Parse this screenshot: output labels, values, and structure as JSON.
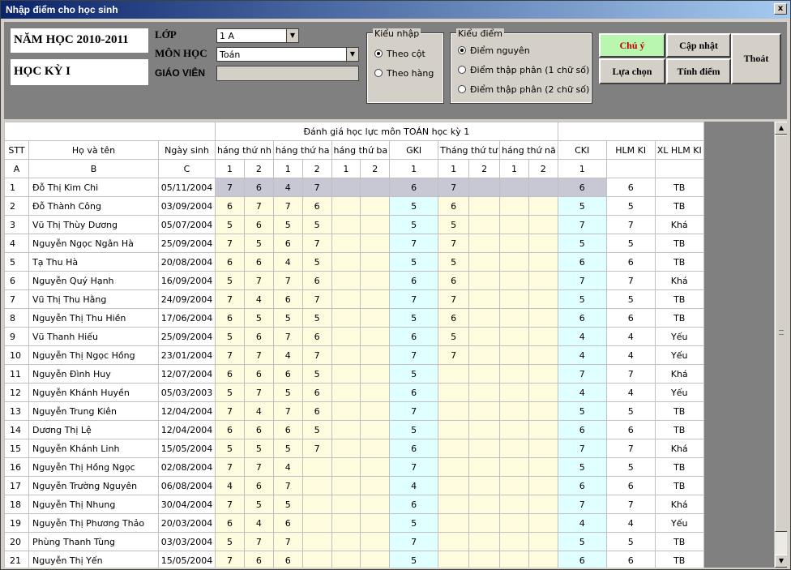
{
  "window": {
    "title": "Nhập điểm cho học sinh",
    "close_label": "x"
  },
  "header": {
    "year": "NĂM HỌC 2010-2011",
    "term": "HỌC KỲ I",
    "class_label": "LỚP",
    "class_value": "1 A",
    "subject_label": "MÔN HỌC",
    "subject_value": "Toán",
    "teacher_label": "GIÁO VIÊN",
    "teacher_value": ""
  },
  "input_mode": {
    "legend": "Kiểu nhập",
    "options": [
      "Theo cột",
      "Theo hàng"
    ],
    "selected": 0
  },
  "score_type": {
    "legend": "Kiểu điểm",
    "options": [
      "Điểm nguyên",
      "Điểm thập phân (1 chữ số)",
      "Điểm thập phân (2 chữ số)"
    ],
    "selected": 0
  },
  "buttons": {
    "note": "Chú ý",
    "update": "Cập nhật",
    "exit": "Thoát",
    "choose": "Lựa chọn",
    "calc": "Tính điểm"
  },
  "grid": {
    "title": "Đánh giá học lực môn TOÁN học kỳ 1",
    "columns": [
      "STT",
      "Họ và tên",
      "Ngày sinh",
      "háng thứ nh",
      "háng thứ ha",
      "háng thứ ba",
      "GKI",
      "Tháng thứ tư",
      "háng thứ nă",
      "CKI",
      "HLM KI",
      "XL HLM KI"
    ],
    "letters": [
      "A",
      "B",
      "C"
    ],
    "sub": [
      "1",
      "2",
      "1",
      "2",
      "1",
      "2",
      "1",
      "1",
      "2",
      "1",
      "2",
      "1"
    ],
    "rows": [
      [
        "1",
        "Đỗ Thị Kim Chi",
        "05/11/2004",
        "7",
        "6",
        "4",
        "7",
        "",
        "",
        "6",
        "7",
        "",
        "",
        "",
        "6",
        "6",
        "TB"
      ],
      [
        "2",
        "Đỗ Thành Công",
        "03/09/2004",
        "6",
        "7",
        "7",
        "6",
        "",
        "",
        "5",
        "6",
        "",
        "",
        "",
        "5",
        "5",
        "TB"
      ],
      [
        "3",
        "Vũ Thị Thùy Dương",
        "05/07/2004",
        "5",
        "6",
        "5",
        "5",
        "",
        "",
        "5",
        "5",
        "",
        "",
        "",
        "7",
        "7",
        "Khá"
      ],
      [
        "4",
        "Nguyễn Ngọc Ngân Hà",
        "25/09/2004",
        "7",
        "5",
        "6",
        "7",
        "",
        "",
        "7",
        "7",
        "",
        "",
        "",
        "5",
        "5",
        "TB"
      ],
      [
        "5",
        "Tạ Thu Hà",
        "20/08/2004",
        "6",
        "6",
        "4",
        "5",
        "",
        "",
        "5",
        "5",
        "",
        "",
        "",
        "6",
        "6",
        "TB"
      ],
      [
        "6",
        "Nguyễn Quý Hạnh",
        "16/09/2004",
        "5",
        "7",
        "7",
        "6",
        "",
        "",
        "6",
        "6",
        "",
        "",
        "",
        "7",
        "7",
        "Khá"
      ],
      [
        "7",
        "Vũ Thị Thu Hằng",
        "24/09/2004",
        "7",
        "4",
        "6",
        "7",
        "",
        "",
        "7",
        "7",
        "",
        "",
        "",
        "5",
        "5",
        "TB"
      ],
      [
        "8",
        "Nguyễn Thị Thu Hiền",
        "17/06/2004",
        "6",
        "5",
        "5",
        "5",
        "",
        "",
        "5",
        "6",
        "",
        "",
        "",
        "6",
        "6",
        "TB"
      ],
      [
        "9",
        "Vũ Thanh Hiếu",
        "25/09/2004",
        "5",
        "6",
        "7",
        "6",
        "",
        "",
        "6",
        "5",
        "",
        "",
        "",
        "4",
        "4",
        "Yếu"
      ],
      [
        "10",
        "Nguyễn Thị Ngọc Hồng",
        "23/01/2004",
        "7",
        "7",
        "4",
        "7",
        "",
        "",
        "7",
        "7",
        "",
        "",
        "",
        "4",
        "4",
        "Yếu"
      ],
      [
        "11",
        "Nguyễn Đình Huy",
        "12/07/2004",
        "6",
        "6",
        "6",
        "5",
        "",
        "",
        "5",
        "",
        "",
        "",
        "",
        "7",
        "7",
        "Khá"
      ],
      [
        "12",
        "Nguyễn Khánh Huyền",
        "05/03/2003",
        "5",
        "7",
        "5",
        "6",
        "",
        "",
        "6",
        "",
        "",
        "",
        "",
        "4",
        "4",
        "Yếu"
      ],
      [
        "13",
        "Nguyễn Trung Kiên",
        "12/04/2004",
        "7",
        "4",
        "7",
        "6",
        "",
        "",
        "7",
        "",
        "",
        "",
        "",
        "5",
        "5",
        "TB"
      ],
      [
        "14",
        "Dương Thị Lệ",
        "12/04/2004",
        "6",
        "6",
        "6",
        "5",
        "",
        "",
        "5",
        "",
        "",
        "",
        "",
        "6",
        "6",
        "TB"
      ],
      [
        "15",
        "Nguyễn Khánh Linh",
        "15/05/2004",
        "5",
        "5",
        "5",
        "7",
        "",
        "",
        "6",
        "",
        "",
        "",
        "",
        "7",
        "7",
        "Khá"
      ],
      [
        "16",
        "Nguyễn Thị Hồng Ngọc",
        "02/08/2004",
        "7",
        "7",
        "4",
        "",
        "",
        "",
        "7",
        "",
        "",
        "",
        "",
        "5",
        "5",
        "TB"
      ],
      [
        "17",
        "Nguyễn Trường Nguyên",
        "06/08/2004",
        "4",
        "6",
        "7",
        "",
        "",
        "",
        "4",
        "",
        "",
        "",
        "",
        "6",
        "6",
        "TB"
      ],
      [
        "18",
        "Nguyễn Thị Nhung",
        "30/04/2004",
        "7",
        "5",
        "5",
        "",
        "",
        "",
        "6",
        "",
        "",
        "",
        "",
        "7",
        "7",
        "Khá"
      ],
      [
        "19",
        "Nguyễn Thị Phương Thảo",
        "20/03/2004",
        "6",
        "4",
        "6",
        "",
        "",
        "",
        "5",
        "",
        "",
        "",
        "",
        "4",
        "4",
        "Yếu"
      ],
      [
        "20",
        "Phùng Thanh Tùng",
        "03/03/2004",
        "5",
        "7",
        "7",
        "",
        "",
        "",
        "7",
        "",
        "",
        "",
        "",
        "5",
        "5",
        "TB"
      ],
      [
        "21",
        "Nguyễn Thị Yến",
        "15/05/2004",
        "7",
        "6",
        "6",
        "",
        "",
        "",
        "5",
        "",
        "",
        "",
        "",
        "6",
        "6",
        "TB"
      ]
    ]
  },
  "colors": {
    "accent_green": "#b9f7b0",
    "accent_red": "#c00000",
    "month_fill": "#fffbdf",
    "term_fill": "#e0ffff"
  }
}
